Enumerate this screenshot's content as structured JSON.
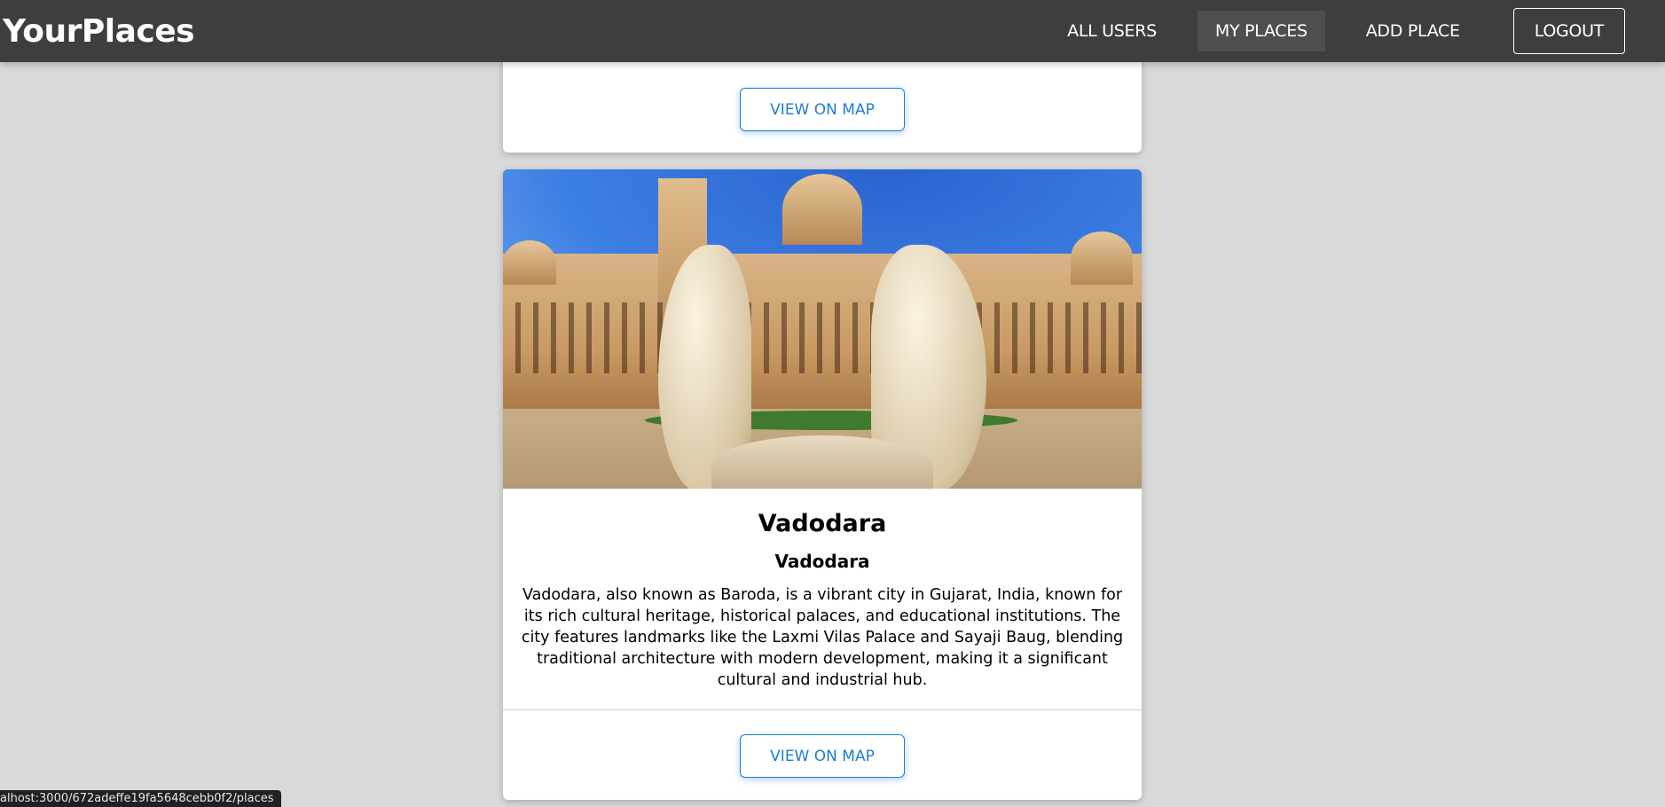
{
  "header": {
    "brand": "YourPlaces",
    "nav": {
      "all_users": "ALL USERS",
      "my_places": "MY PLACES",
      "add_place": "ADD PLACE",
      "logout": "LOGOUT"
    }
  },
  "places": [
    {
      "view_on_map_label": "VIEW ON MAP"
    },
    {
      "title": "Vadodara",
      "address": "Vadodara",
      "description": "Vadodara, also known as Baroda, is a vibrant city in Gujarat, India, known for its rich cultural heritage, historical palaces, and educational institutions. The city features landmarks like the Laxmi Vilas Palace and Sayaji Baug, blending traditional architecture with modern development, making it a significant cultural and industrial hub.",
      "view_on_map_label": "VIEW ON MAP"
    }
  ],
  "status_bar": {
    "url": "alhost:3000/672adeffe19fa5648cebb0f2/places"
  },
  "colors": {
    "header_bg": "#3e3e3e",
    "page_bg": "#d9d9d9",
    "accent": "#1e7ad6"
  }
}
